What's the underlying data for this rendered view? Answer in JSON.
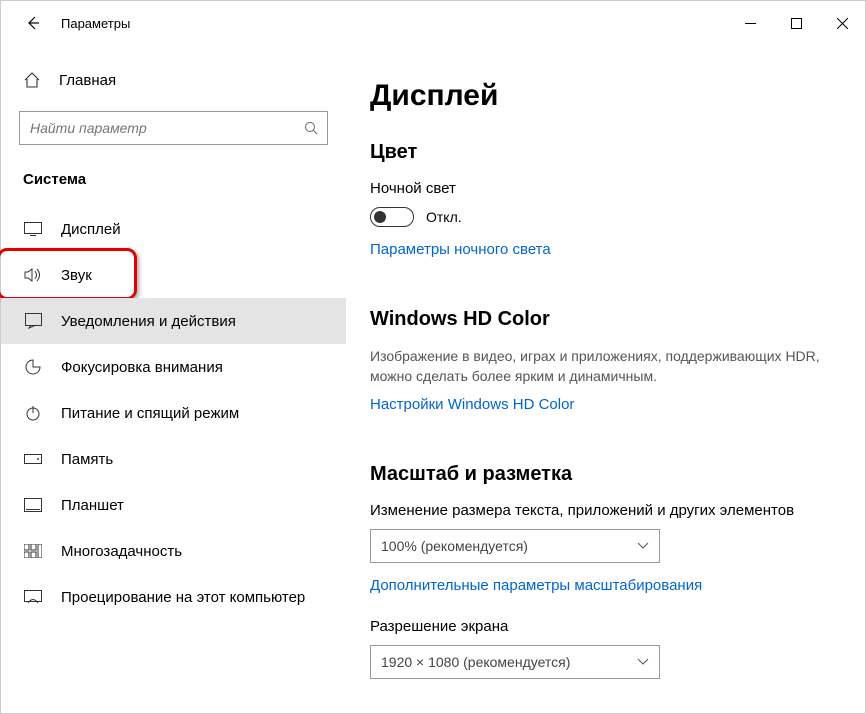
{
  "titlebar": {
    "title": "Параметры"
  },
  "sidebar": {
    "home_label": "Главная",
    "search_placeholder": "Найти параметр",
    "section_title": "Система",
    "items": [
      {
        "label": "Дисплей"
      },
      {
        "label": "Звук"
      },
      {
        "label": "Уведомления и действия"
      },
      {
        "label": "Фокусировка внимания"
      },
      {
        "label": "Питание и спящий режим"
      },
      {
        "label": "Память"
      },
      {
        "label": "Планшет"
      },
      {
        "label": "Многозадачность"
      },
      {
        "label": "Проецирование на этот компьютер"
      }
    ]
  },
  "main": {
    "page_title": "Дисплей",
    "color": {
      "heading": "Цвет",
      "night_light_label": "Ночной свет",
      "toggle_state": "Откл.",
      "night_light_settings": "Параметры ночного света"
    },
    "hdcolor": {
      "heading": "Windows HD Color",
      "desc": "Изображение в видео, играх и приложениях, поддерживающих HDR, можно сделать более ярким и динамичным.",
      "link": "Настройки Windows HD Color"
    },
    "scale": {
      "heading": "Масштаб и разметка",
      "scale_label": "Изменение размера текста, приложений и других элементов",
      "scale_value": "100% (рекомендуется)",
      "advanced_scaling": "Дополнительные параметры масштабирования",
      "resolution_label": "Разрешение экрана",
      "resolution_value": "1920 × 1080 (рекомендуется)"
    }
  }
}
